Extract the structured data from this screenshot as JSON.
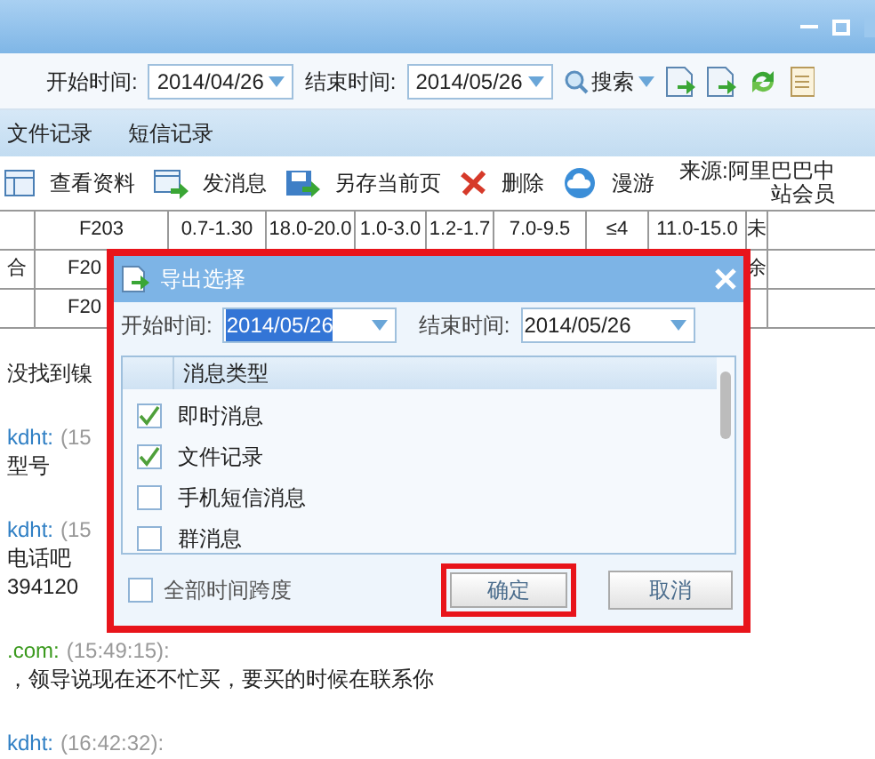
{
  "toolbar": {
    "start_label": "开始时间:",
    "start_value": "2014/04/26",
    "end_label": "结束时间:",
    "end_value": "2014/05/26",
    "search_label": "搜索"
  },
  "tabs": [
    "文件记录",
    "短信记录"
  ],
  "actions": [
    {
      "label": "查看资料",
      "kind": "card"
    },
    {
      "label": "发消息",
      "kind": "send"
    },
    {
      "label": "另存当前页",
      "kind": "save"
    },
    {
      "label": "删除",
      "kind": "delete"
    },
    {
      "label": "漫游",
      "kind": "cloud"
    }
  ],
  "source": [
    "来源:阿里巴巴中",
    "站会员"
  ],
  "table": {
    "rows": [
      [
        "",
        "F203",
        "0.7-1.30",
        "18.0-20.0",
        "1.0-3.0",
        "1.2-1.7",
        "7.0-9.5",
        "≤4",
        "11.0-15.0",
        "未"
      ],
      [
        "合",
        "F20",
        "",
        "",
        "",
        "",
        "",
        "",
        "",
        "余"
      ],
      [
        "",
        "F20",
        "",
        "",
        "",
        "",
        "",
        "",
        "",
        ""
      ]
    ]
  },
  "chat": [
    {
      "kind": "text",
      "text": "没找到镍"
    },
    {
      "kind": "sender",
      "name": "kdht:",
      "time": "(15",
      "color": "#2f7fc4"
    },
    {
      "kind": "text",
      "text": "型号"
    },
    {
      "kind": "sender",
      "name": "kdht:",
      "time": "(15",
      "color": "#2f7fc4"
    },
    {
      "kind": "text",
      "text": "电话吧"
    },
    {
      "kind": "text",
      "text": "394120"
    },
    {
      "kind": "sender",
      "name": ".com:",
      "time": "(15:49:15):",
      "color": "#3b9a1e"
    },
    {
      "kind": "text",
      "text": "，领导说现在还不忙买，要买的时候在联系你"
    },
    {
      "kind": "sender",
      "name": "kdht:",
      "time": "(16:42:32):",
      "color": "#2f7fc4"
    }
  ],
  "dialog": {
    "title": "导出选择",
    "start_label": "开始时间:",
    "start_value": "2014/05/26",
    "end_label": "结束时间:",
    "end_value": "2014/05/26",
    "list_header": "消息类型",
    "items": [
      {
        "label": "即时消息",
        "checked": true
      },
      {
        "label": "文件记录",
        "checked": true
      },
      {
        "label": "手机短信消息",
        "checked": false
      },
      {
        "label": "群消息",
        "checked": false
      }
    ],
    "all_time": {
      "label": "全部时间跨度",
      "checked": false
    },
    "ok": "确定",
    "cancel": "取消"
  }
}
